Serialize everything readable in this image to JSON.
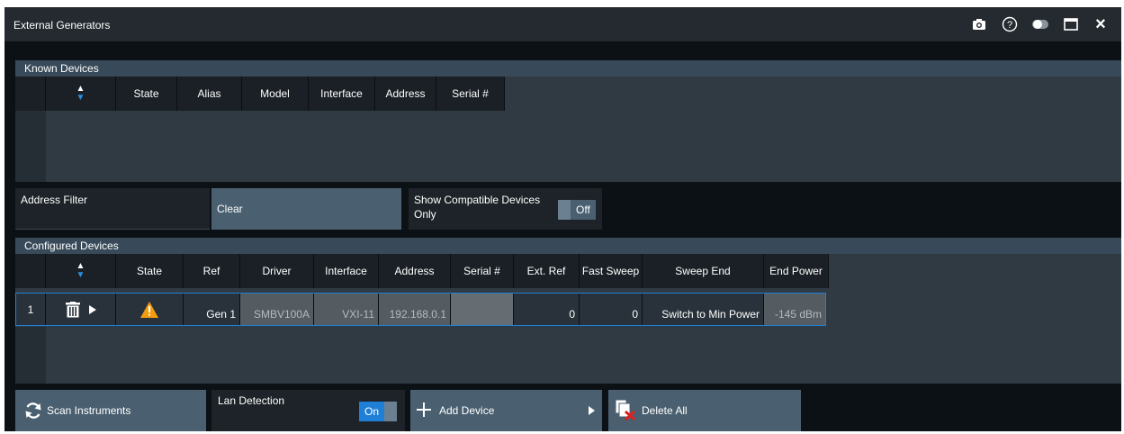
{
  "window": {
    "title": "External Generators"
  },
  "titlebar_icons": [
    "camera-icon",
    "help-icon",
    "toggle-icon",
    "maximize-icon",
    "close-icon"
  ],
  "help_glyph": "?",
  "close_glyph": "×",
  "known_devices": {
    "header": "Known Devices",
    "columns": [
      "State",
      "Alias",
      "Model",
      "Interface",
      "Address",
      "Serial #"
    ],
    "rows": []
  },
  "address_filter": {
    "label": "Address Filter",
    "value": ""
  },
  "clear_button": {
    "label": "Clear"
  },
  "show_compatible": {
    "label": "Show Compatible Devices Only",
    "state": "Off"
  },
  "configured_devices": {
    "header": "Configured Devices",
    "columns": [
      "State",
      "Ref",
      "Driver",
      "Interface",
      "Address",
      "Serial #",
      "Ext. Ref",
      "Fast Sweep",
      "Sweep End",
      "End Power"
    ],
    "rows": [
      {
        "index": "1",
        "state_icon": "warning-icon",
        "ref": "Gen 1",
        "driver": "SMBV100A",
        "interface": "VXI-11",
        "address": "192.168.0.1",
        "serial": "",
        "ext_ref": "0",
        "fast_sweep": "0",
        "sweep_end": "Switch to Min Power",
        "end_power": "-145 dBm"
      }
    ]
  },
  "scan_button": {
    "label": "Scan Instruments"
  },
  "lan_detection": {
    "label": "Lan Detection",
    "state": "On"
  },
  "add_device": {
    "label": "Add Device"
  },
  "delete_all": {
    "label": "Delete All"
  },
  "colors": {
    "accent": "#1f7fd6",
    "button": "#4a6070",
    "header": "#384a59",
    "warning": "#f39c12"
  }
}
